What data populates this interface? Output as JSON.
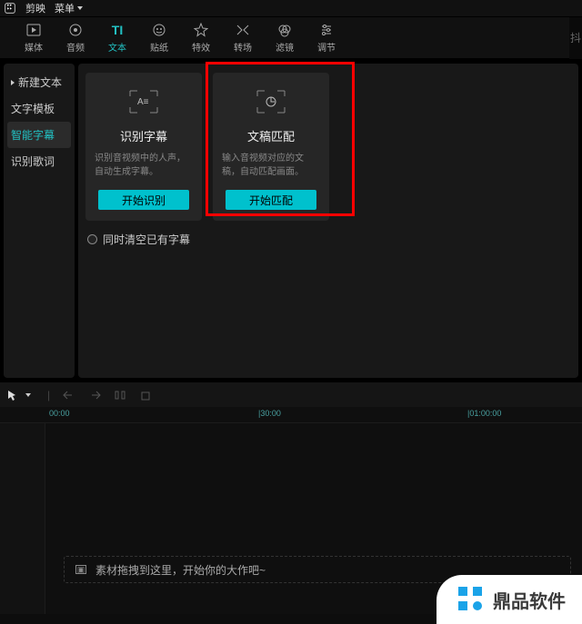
{
  "titlebar": {
    "app_name": "剪映",
    "menu_label": "菜单"
  },
  "nav": {
    "tabs": [
      {
        "label": "媒体"
      },
      {
        "label": "音频"
      },
      {
        "label": "文本"
      },
      {
        "label": "贴纸"
      },
      {
        "label": "特效"
      },
      {
        "label": "转场"
      },
      {
        "label": "滤镜"
      },
      {
        "label": "调节"
      }
    ]
  },
  "sidebar": {
    "items": [
      {
        "label": "新建文本"
      },
      {
        "label": "文字模板"
      },
      {
        "label": "智能字幕"
      },
      {
        "label": "识别歌词"
      }
    ]
  },
  "cards": {
    "recognize": {
      "title": "识别字幕",
      "desc": "识别音视频中的人声，自动生成字幕。",
      "button": "开始识别"
    },
    "match": {
      "title": "文稿匹配",
      "desc": "输入音视频对应的文稿，自动匹配画面。",
      "button": "开始匹配"
    }
  },
  "checkbox": {
    "label": "同时清空已有字幕"
  },
  "ruler": {
    "ticks": [
      "00:00",
      "|30:00",
      "|01:00:00"
    ]
  },
  "timeline": {
    "drop_hint": "素材拖拽到这里，开始你的大作吧~"
  },
  "watermark": {
    "brand": "鼎品软件"
  },
  "colors": {
    "accent": "#00c1cd",
    "highlight": "#f00"
  }
}
